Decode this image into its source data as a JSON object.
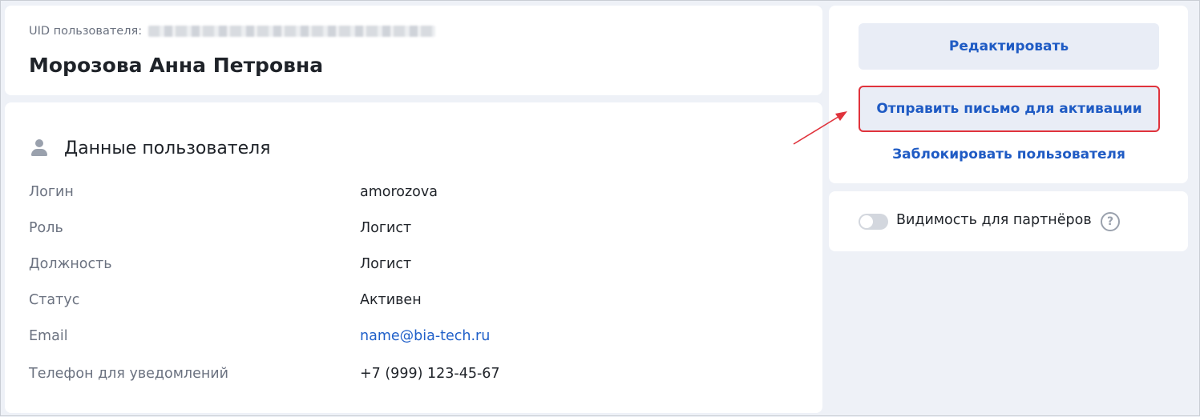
{
  "header": {
    "uid_label": "UID пользователя:",
    "user_name": "Морозова Анна Петровна"
  },
  "details": {
    "section_title": "Данные пользователя",
    "section_icon": "person-icon",
    "fields": [
      {
        "label": "Логин",
        "value": "amorozova"
      },
      {
        "label": "Роль",
        "value": "Логист"
      },
      {
        "label": "Должность",
        "value": "Логист"
      },
      {
        "label": "Статус",
        "value": "Активен"
      },
      {
        "label": "Email",
        "value": "name@bia-tech.ru"
      },
      {
        "label": "Телефон для уведомлений",
        "value": "+7 (999) 123-45-67"
      }
    ]
  },
  "actions": {
    "edit_label": "Редактировать",
    "send_activation_label": "Отправить письмо для активации",
    "block_user_label": "Заблокировать пользователя"
  },
  "visibility": {
    "label": "Видимость для партнёров",
    "toggle_on": false,
    "help_icon": "question-circle-icon",
    "help_glyph": "?"
  },
  "colors": {
    "accent": "#1f5bc4",
    "link": "#2060c9",
    "highlight_border": "#e0333c",
    "button_bg": "#e9edf6",
    "page_bg": "#eef1f7"
  }
}
